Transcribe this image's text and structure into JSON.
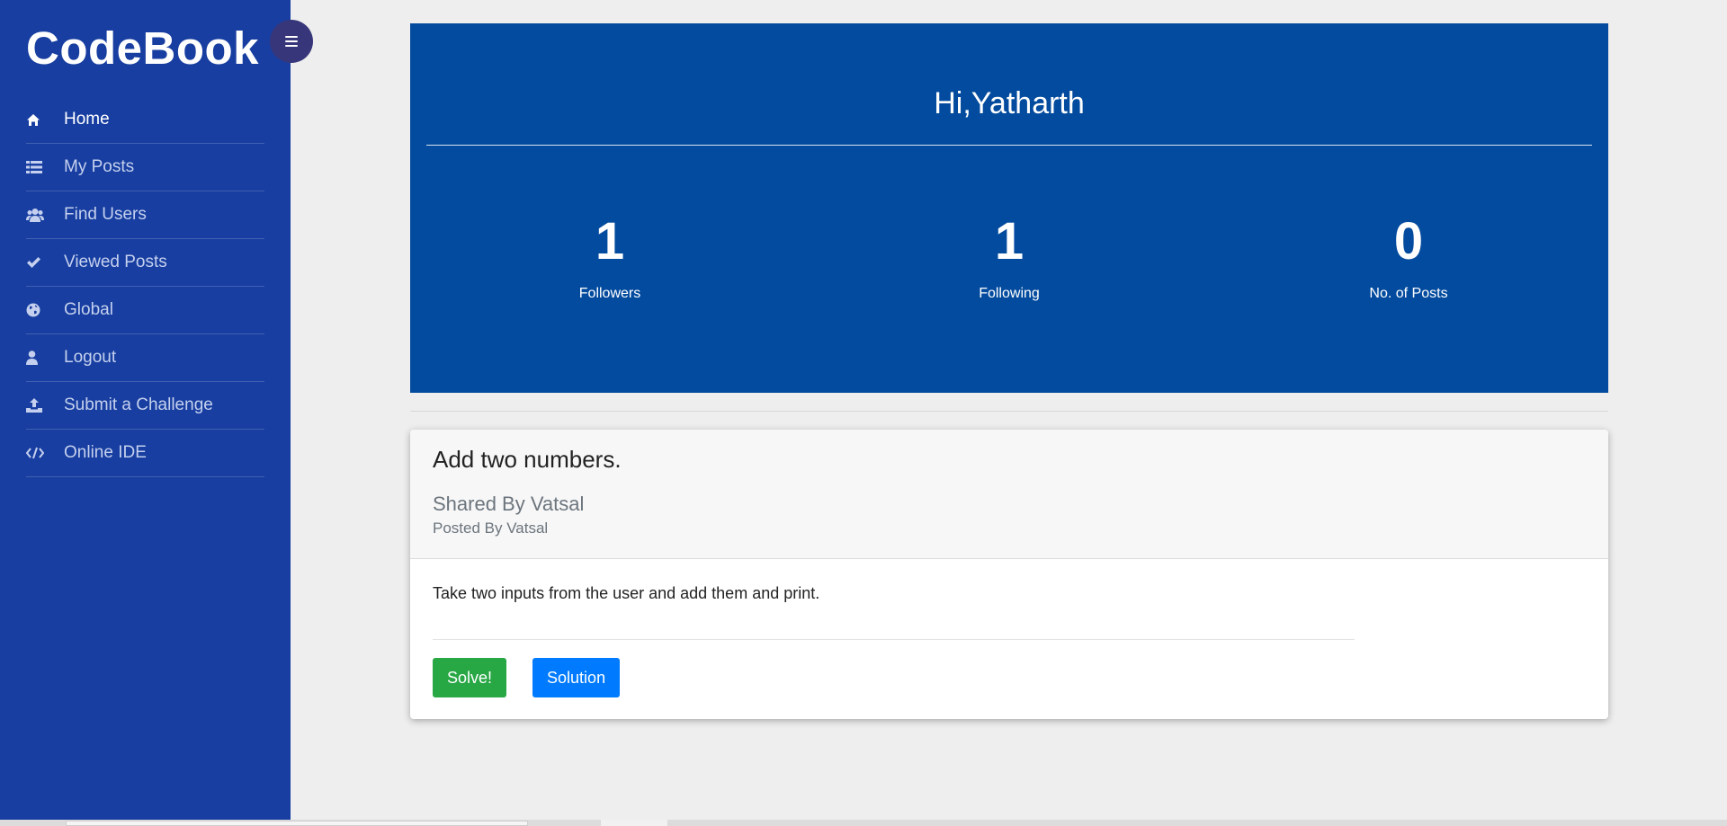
{
  "sidebar": {
    "brand": "CodeBook",
    "toggle_icon": "hamburger-icon",
    "background": "#173ea0",
    "items": [
      {
        "label": "Home",
        "icon": "home-icon",
        "active": true
      },
      {
        "label": "My Posts",
        "icon": "list-icon"
      },
      {
        "label": "Find Users",
        "icon": "users-icon"
      },
      {
        "label": "Viewed Posts",
        "icon": "check-icon"
      },
      {
        "label": "Global",
        "icon": "globe-icon"
      },
      {
        "label": "Logout",
        "icon": "user-icon"
      },
      {
        "label": "Submit a Challenge",
        "icon": "upload-icon"
      },
      {
        "label": "Online IDE",
        "icon": "code-icon"
      }
    ]
  },
  "hero": {
    "greeting": "Hi,Yatharth",
    "background": "#034b9e",
    "stats": [
      {
        "value": "1",
        "label": "Followers"
      },
      {
        "value": "1",
        "label": "Following"
      },
      {
        "value": "0",
        "label": "No. of Posts"
      }
    ]
  },
  "post": {
    "title": "Add two numbers.",
    "shared_by": "Shared By Vatsal",
    "posted_by": "Posted By Vatsal",
    "description": "Take two inputs from the user and add them and print.",
    "solve_label": "Solve!",
    "solution_label": "Solution",
    "solve_color": "#28a745",
    "solution_color": "#007bff"
  }
}
